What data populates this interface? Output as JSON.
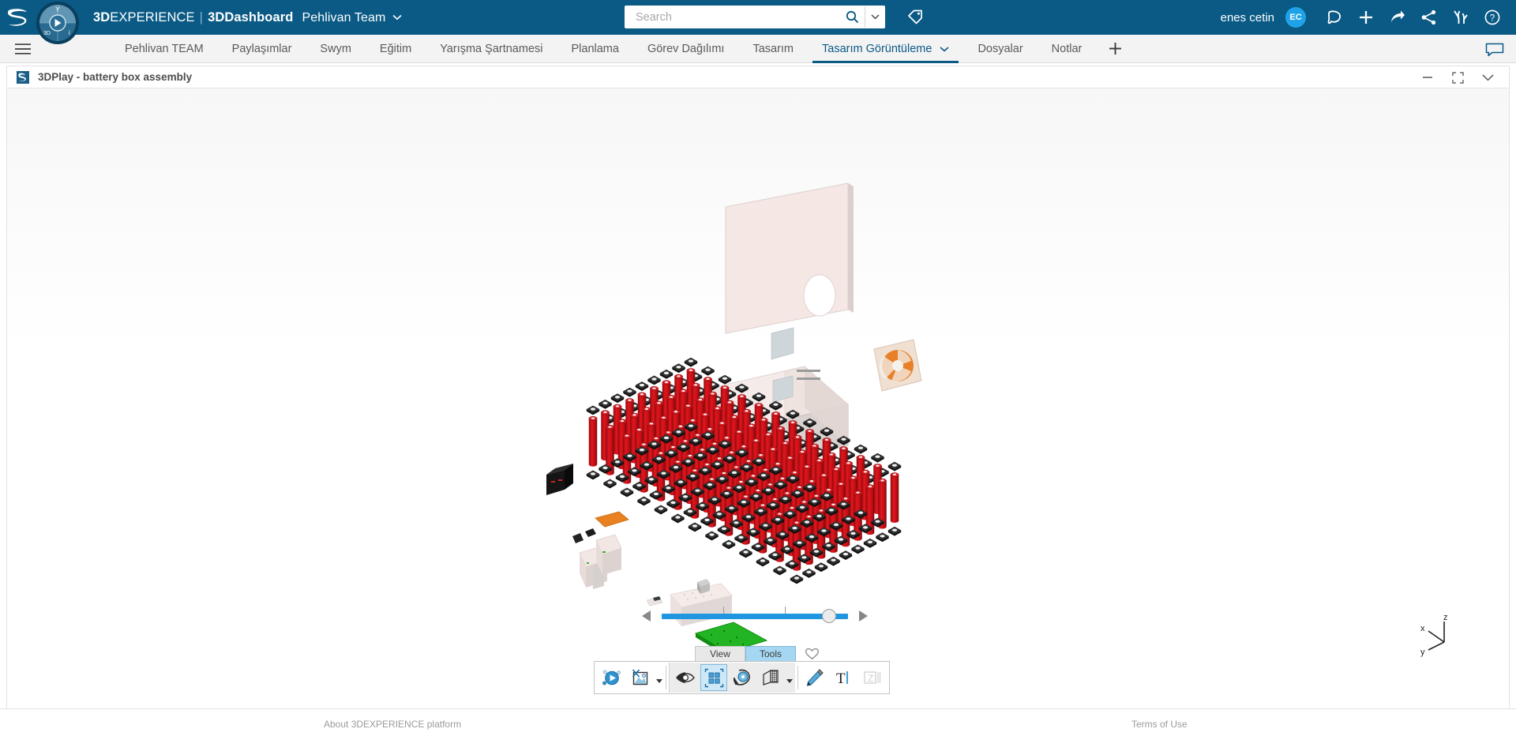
{
  "header": {
    "logo_icon": "ds-logo-icon",
    "compass_icon": "3dexperience-compass-icon",
    "brand_3d": "3D",
    "brand_experience": "EXPERIENCE",
    "brand_separator": "|",
    "brand_dashboard": "3DDashboard",
    "brand_team": "Pehlivan Team",
    "brand_caret": "⌄",
    "search": {
      "placeholder": "Search",
      "value": "",
      "search_icon": "search-icon",
      "caret_icon": "chevron-down-icon"
    },
    "tag_icon": "tag-icon",
    "user_name": "enes cetin",
    "avatar_initials": "EC",
    "icons": [
      {
        "name": "notification-bell-icon",
        "glyph": "bell"
      },
      {
        "name": "add-icon",
        "glyph": "plus"
      },
      {
        "name": "share-arrow-icon",
        "glyph": "arrow"
      },
      {
        "name": "share-network-icon",
        "glyph": "share"
      },
      {
        "name": "collaborative-tasks-icon",
        "glyph": "tasks"
      },
      {
        "name": "help-icon",
        "glyph": "question"
      }
    ],
    "accent_color": "#0a5a85",
    "avatar_color": "#1fa3e8"
  },
  "tabs": {
    "menu_icon": "hamburger-menu-icon",
    "items": [
      {
        "label": "Pehlivan TEAM",
        "active": false,
        "caret": false
      },
      {
        "label": "Paylaşımlar",
        "active": false,
        "caret": false
      },
      {
        "label": "Swym",
        "active": false,
        "caret": false
      },
      {
        "label": "Eğitim",
        "active": false,
        "caret": false
      },
      {
        "label": "Yarışma Şartnamesi",
        "active": false,
        "caret": false
      },
      {
        "label": "Planlama",
        "active": false,
        "caret": false
      },
      {
        "label": "Görev Dağılımı",
        "active": false,
        "caret": false
      },
      {
        "label": "Tasarım",
        "active": false,
        "caret": false
      },
      {
        "label": "Tasarım Görüntüleme",
        "active": true,
        "caret": true
      },
      {
        "label": "Dosyalar",
        "active": false,
        "caret": false
      },
      {
        "label": "Notlar",
        "active": false,
        "caret": false
      }
    ],
    "add_tab_label": "+",
    "chat_icon": "chat-bubble-icon"
  },
  "widget": {
    "app_icon": "3dplay-icon",
    "title": "3DPlay - battery box assembly",
    "controls": [
      {
        "name": "minimize-button",
        "glyph": "minus"
      },
      {
        "name": "fullscreen-button",
        "glyph": "expand"
      },
      {
        "name": "collapse-button",
        "glyph": "chevron-down"
      }
    ]
  },
  "viewer": {
    "slider": {
      "prev_icon": "previous-step-icon",
      "next_icon": "next-step-icon",
      "value": 90,
      "min": 0,
      "max": 100,
      "ticks": [
        33,
        66
      ],
      "track_color": "#2196e0"
    },
    "axis_triad": {
      "x": "x",
      "y": "y",
      "z": "z"
    },
    "mini_tabs": [
      {
        "label": "View",
        "active": false
      },
      {
        "label": "Tools",
        "active": true
      }
    ],
    "favorite_icon": "heart-icon",
    "toolbar": [
      {
        "name": "play-animation-button",
        "icon": "play-circle-icon",
        "selected": false,
        "caret": false
      },
      {
        "name": "snapshot-button",
        "icon": "image-snapshot-icon",
        "selected": false,
        "caret": true
      },
      {
        "name": "visibility-button",
        "icon": "eye-icon",
        "selected": false,
        "caret": false
      },
      {
        "name": "explode-button",
        "icon": "explode-grid-icon",
        "selected": true,
        "caret": false
      },
      {
        "name": "measure-button",
        "icon": "tape-measure-icon",
        "selected": false,
        "caret": false
      },
      {
        "name": "section-button",
        "icon": "section-plane-icon",
        "selected": false,
        "caret": true
      },
      {
        "name": "markup-pencil-button",
        "icon": "pencil-icon",
        "selected": false,
        "caret": false
      },
      {
        "name": "text-annotation-button",
        "icon": "text-icon",
        "selected": false,
        "caret": false
      },
      {
        "name": "dimension-button",
        "icon": "dimension-icon",
        "selected": false,
        "caret": false,
        "disabled": true
      }
    ],
    "model": {
      "name": "battery box assembly",
      "cell_color": "#cc0f16",
      "holder_color": "#2e2e2e",
      "enclosure_color": "#f0e3e0",
      "pcb_color": "#22b422",
      "fan_color": "#e8802a"
    }
  },
  "footer": {
    "about_label": "About 3DEXPERIENCE platform",
    "terms_label": "Terms of Use"
  }
}
